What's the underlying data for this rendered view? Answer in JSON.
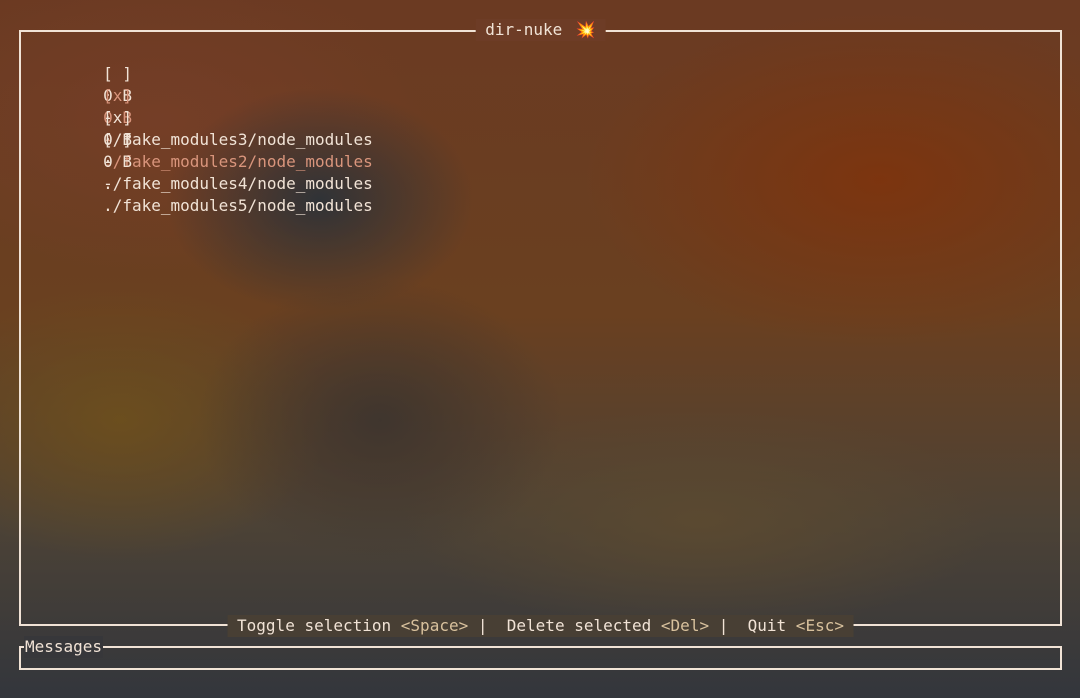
{
  "app": {
    "title": "dir-nuke",
    "title_icon": "💥"
  },
  "list": {
    "items": [
      {
        "check": "[ ]",
        "size": "0 B",
        "path": "./fake_modules3/node_modules",
        "active": false
      },
      {
        "check": "[x]",
        "size": "0 B",
        "path": "./fake_modules2/node_modules",
        "active": true
      },
      {
        "check": "[x]",
        "size": "0 B",
        "path": "./fake_modules4/node_modules",
        "active": false
      },
      {
        "check": "[ ]",
        "size": "0 B",
        "path": "./fake_modules5/node_modules",
        "active": false
      }
    ]
  },
  "footer": {
    "toggle_label": "Toggle selection",
    "toggle_key": "<Space>",
    "delete_label": "Delete selected",
    "delete_key": "<Del>",
    "quit_label": "Quit",
    "quit_key": "<Esc>",
    "separator": "|"
  },
  "messages": {
    "label": "Messages"
  },
  "colors": {
    "text": "#f1e3d6",
    "active_item": "#d9957c",
    "key_hint": "#d8c19d"
  }
}
